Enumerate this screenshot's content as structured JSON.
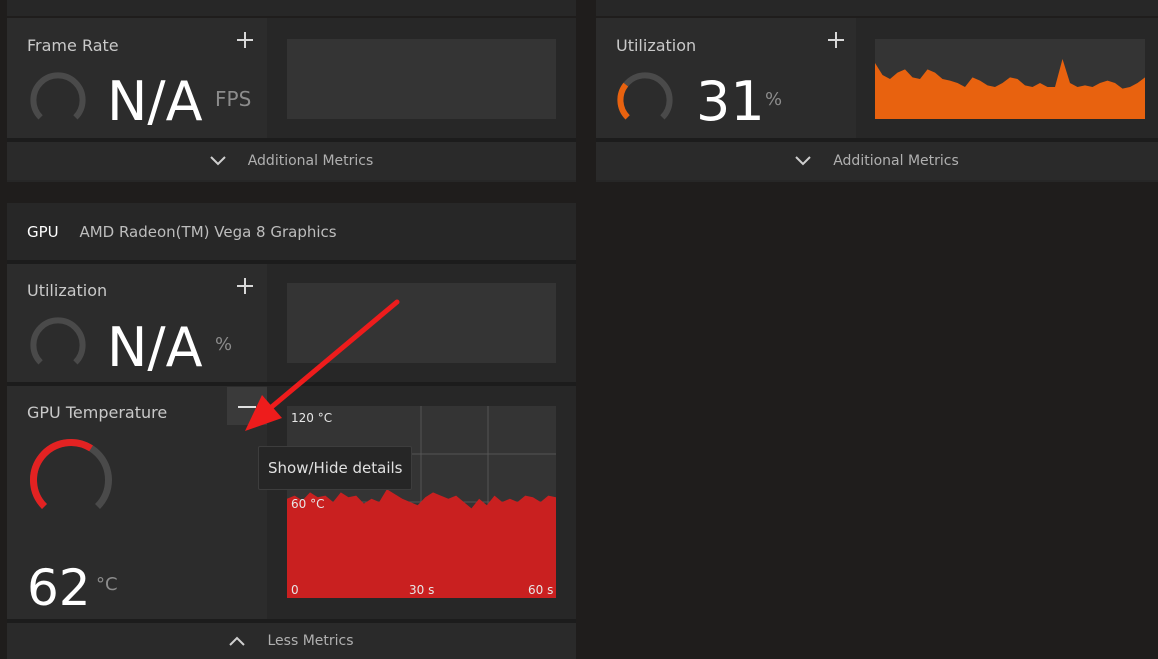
{
  "colors": {
    "accent_orange": "#e8620f",
    "accent_red": "#e32222",
    "annotation_arrow": "#ee1c1c"
  },
  "frame_rate_card": {
    "title": "Frame Rate",
    "add_icon": "plus-icon",
    "value": "N/A",
    "unit": "FPS",
    "footer_label": "Additional Metrics"
  },
  "cpu_util_card": {
    "title": "Utilization",
    "add_icon": "plus-icon",
    "value": "31",
    "unit": "%",
    "gauge_fraction": 0.31,
    "footer_label": "Additional Metrics"
  },
  "gpu_section": {
    "label": "GPU",
    "device_name": "AMD Radeon(TM) Vega 8 Graphics",
    "utilization": {
      "title": "Utilization",
      "add_icon": "plus-icon",
      "value": "N/A",
      "unit": "%"
    },
    "temperature": {
      "title": "GPU Temperature",
      "collapse_icon": "minus-icon",
      "value": "62",
      "unit": "°C",
      "gauge_fraction": 0.62,
      "y_labels": [
        "120 °C",
        "60 °C",
        "0"
      ],
      "x_labels": [
        "30 s",
        "60 s"
      ]
    },
    "footer_label": "Less Metrics"
  },
  "tooltip": "Show/Hide details",
  "chart_data": [
    {
      "type": "area",
      "series": [
        {
          "values": [
            70,
            55,
            50,
            58,
            62,
            52,
            50,
            62,
            58,
            50,
            48,
            45,
            40,
            52,
            48,
            42,
            40,
            45,
            52,
            50,
            42,
            40,
            45,
            40,
            40,
            75,
            45,
            40,
            42,
            40,
            45,
            48,
            45,
            38,
            40,
            45,
            52
          ]
        }
      ],
      "ylim": [
        0,
        100
      ]
    },
    {
      "type": "area",
      "series": [
        {
          "values": [
            62,
            64,
            61,
            66,
            63,
            64,
            60,
            66,
            63,
            64,
            59,
            62,
            60,
            68,
            65,
            62,
            60,
            58,
            63,
            66,
            64,
            62,
            64,
            60,
            56,
            62,
            58,
            64,
            60,
            62,
            60,
            64,
            63,
            60,
            64,
            63
          ]
        }
      ],
      "ylim": [
        0,
        120
      ],
      "xlim": [
        0,
        60
      ]
    }
  ]
}
